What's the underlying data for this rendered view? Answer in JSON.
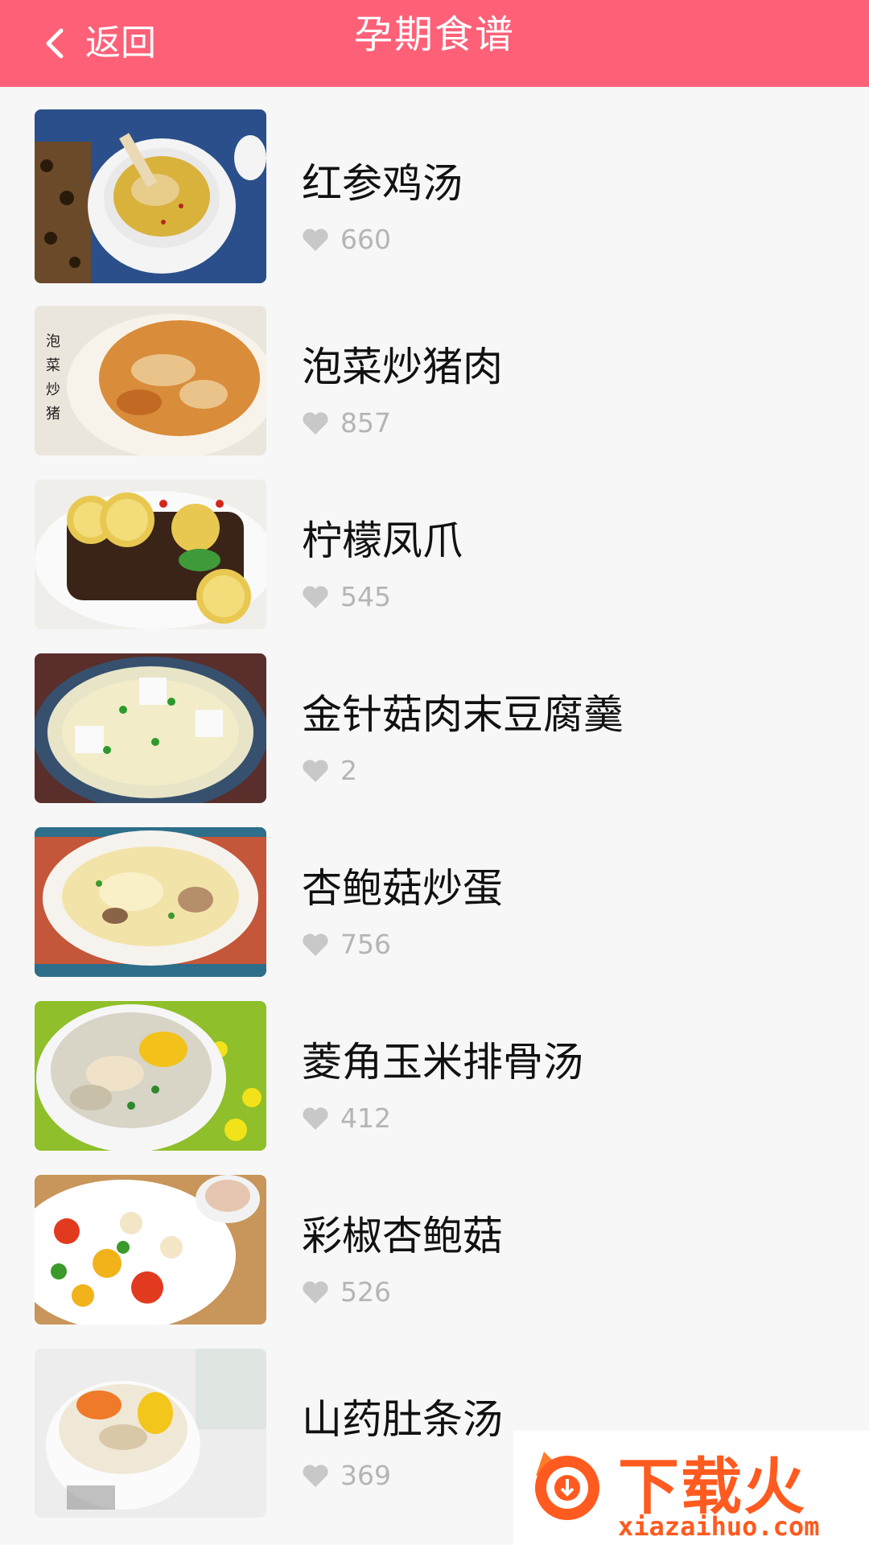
{
  "header": {
    "back_label": "返回",
    "title": "孕期食谱",
    "bg_color": "#fe6078"
  },
  "recipes": [
    {
      "name": "红参鸡汤",
      "likes": "660"
    },
    {
      "name": "泡菜炒猪肉",
      "likes": "857"
    },
    {
      "name": "柠檬凤爪",
      "likes": "545"
    },
    {
      "name": "金针菇肉末豆腐羹",
      "likes": "2"
    },
    {
      "name": "杏鲍菇炒蛋",
      "likes": "756"
    },
    {
      "name": "菱角玉米排骨汤",
      "likes": "412"
    },
    {
      "name": "彩椒杏鲍菇",
      "likes": "526"
    },
    {
      "name": "山药肚条汤",
      "likes": "369"
    }
  ],
  "watermark": {
    "text": "下载火",
    "domain": "xiazaihuo.com"
  }
}
